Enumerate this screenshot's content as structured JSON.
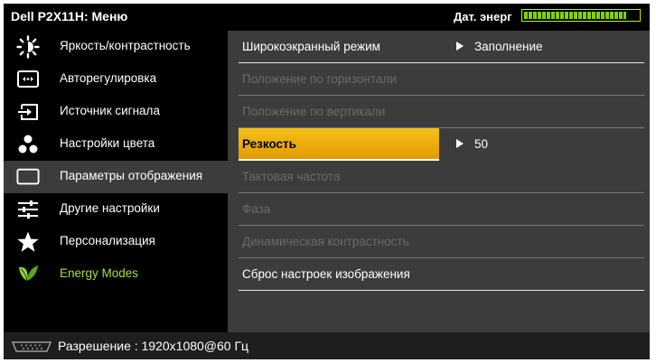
{
  "header": {
    "title": "Dell P2X11H: Меню",
    "energy_label": "Дат. энерг",
    "energy_level": 0.9
  },
  "sidebar": {
    "items": [
      {
        "label": "Яркость/контрастность",
        "icon": "brightness-icon"
      },
      {
        "label": "Авторегулировка",
        "icon": "auto-adjust-icon"
      },
      {
        "label": "Источник сигнала",
        "icon": "input-source-icon"
      },
      {
        "label": "Настройки цвета",
        "icon": "color-settings-icon"
      },
      {
        "label": "Параметры отображения",
        "icon": "display-settings-icon",
        "active": true
      },
      {
        "label": "Другие настройки",
        "icon": "other-settings-icon"
      },
      {
        "label": "Персонализация",
        "icon": "star-icon"
      },
      {
        "label": "Energy Modes",
        "icon": "energy-leaf-icon",
        "accent": "#a6e034"
      }
    ]
  },
  "panel": {
    "rows": [
      {
        "label": "Широкоэкранный режим",
        "value": "Заполнение",
        "state": "enabled"
      },
      {
        "label": "Положение по горизонтали",
        "state": "disabled"
      },
      {
        "label": "Положение по вертикали",
        "state": "disabled"
      },
      {
        "label": "Резкость",
        "value": "50",
        "state": "selected"
      },
      {
        "label": "Тактовая частота",
        "state": "disabled"
      },
      {
        "label": "Фаза",
        "state": "disabled"
      },
      {
        "label": "Динамическая контрастность",
        "state": "disabled"
      },
      {
        "label": "Сброс настроек изображения",
        "state": "enabled"
      }
    ]
  },
  "footer": {
    "resolution": "Разрешение : 1920x1080@60 Гц",
    "icon": "connector-icon"
  },
  "colors": {
    "highlight": "#f0b400",
    "energy_green": "#a6e034",
    "panel_bg": "#3c3c3c"
  }
}
